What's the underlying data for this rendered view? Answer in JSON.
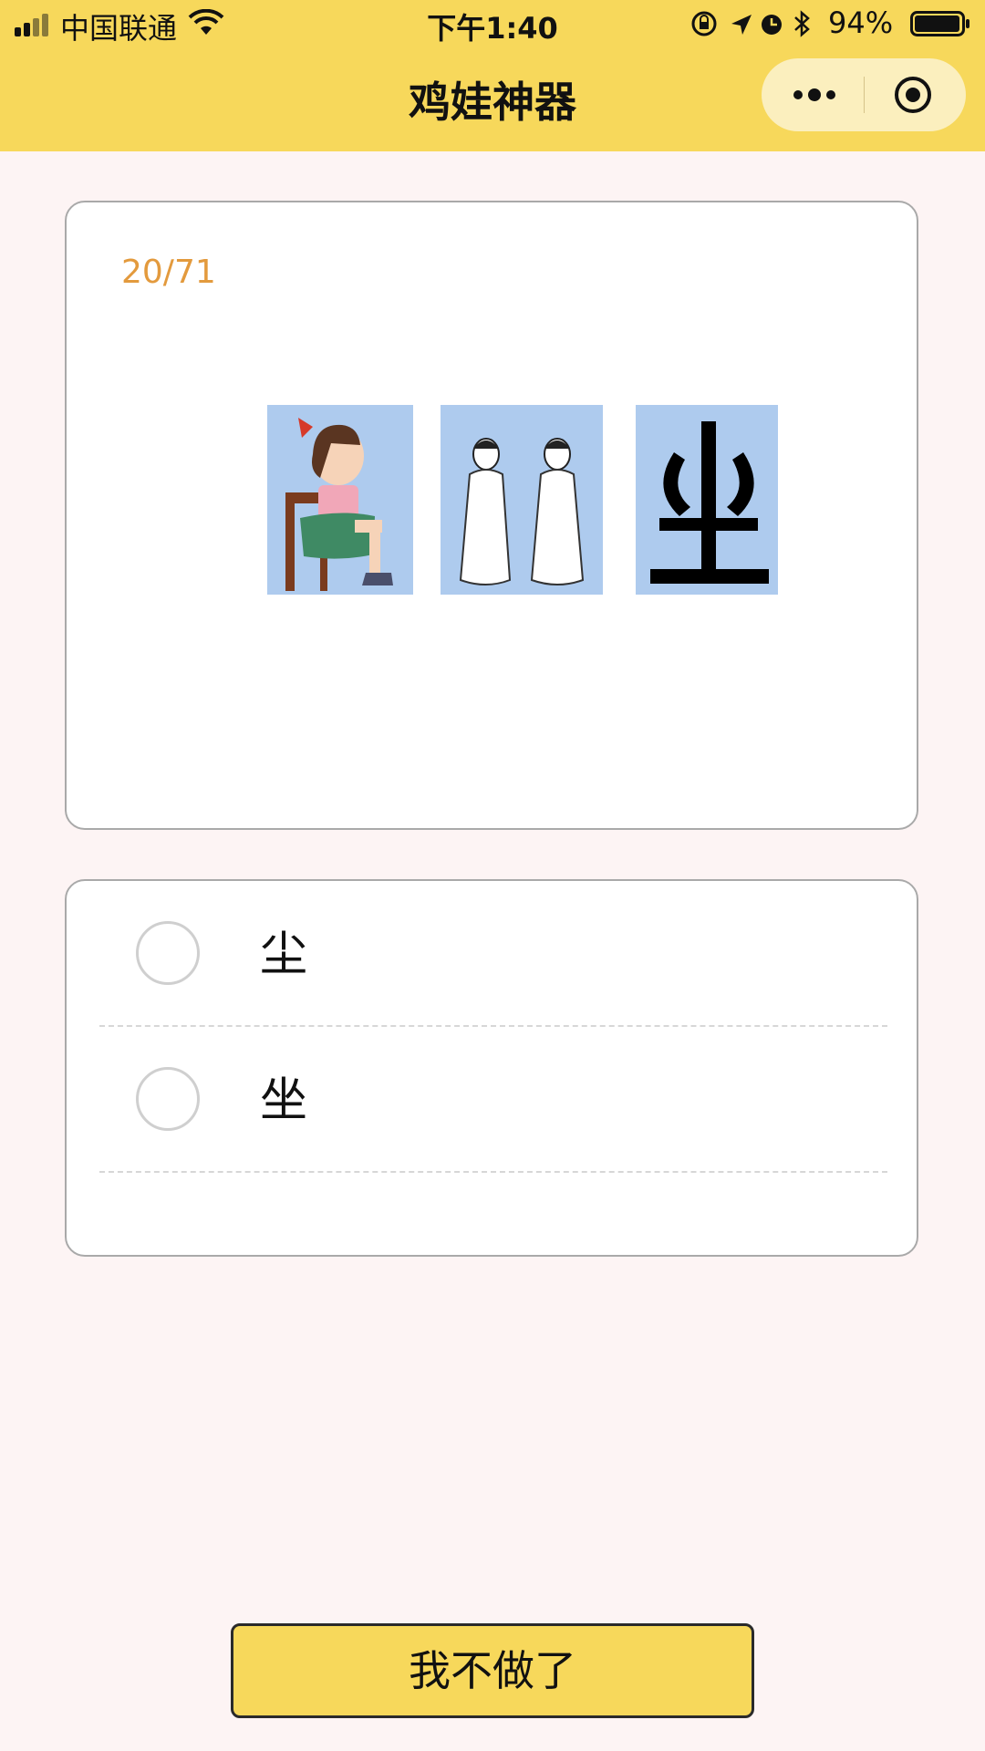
{
  "status_bar": {
    "carrier": "中国联通",
    "time": "下午1:40",
    "battery": "94%"
  },
  "nav": {
    "title": "鸡娃神器"
  },
  "question": {
    "progress": "20/71"
  },
  "options": [
    {
      "label": "尘",
      "selected": false
    },
    {
      "label": "坐",
      "selected": false
    }
  ],
  "quit_button": "我不做了",
  "colors": {
    "accent": "#f7d85b",
    "progress": "#e39a3d",
    "background": "#fdf4f4"
  }
}
